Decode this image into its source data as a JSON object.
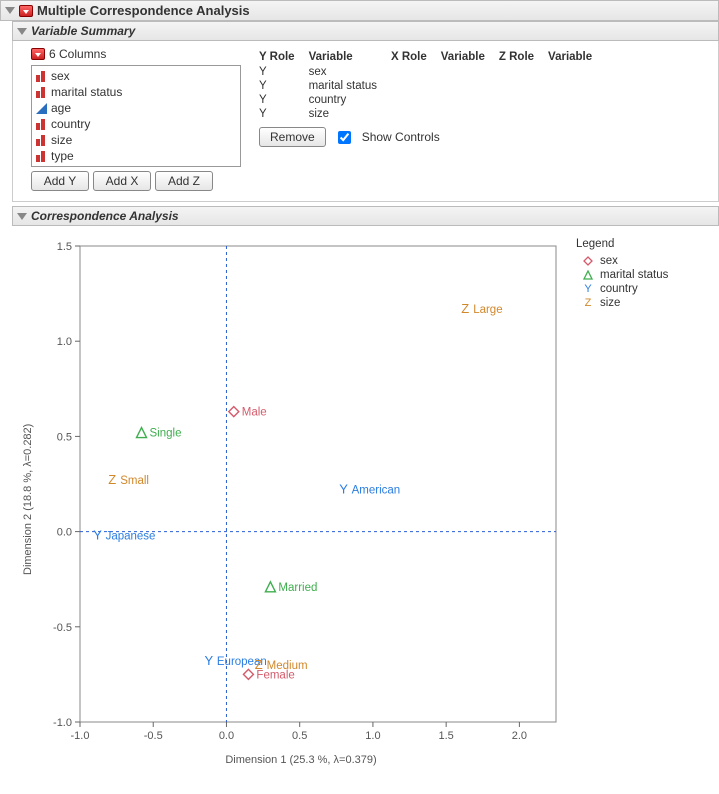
{
  "main_title": "Multiple Correspondence Analysis",
  "variable_summary": {
    "title": "Variable Summary",
    "columns_count_label": "6 Columns",
    "columns": [
      {
        "name": "sex",
        "type": "nominal"
      },
      {
        "name": "marital status",
        "type": "nominal"
      },
      {
        "name": "age",
        "type": "continuous"
      },
      {
        "name": "country",
        "type": "nominal"
      },
      {
        "name": "size",
        "type": "nominal"
      },
      {
        "name": "type",
        "type": "nominal"
      }
    ],
    "buttons": {
      "add_y": "Add Y",
      "add_x": "Add X",
      "add_z": "Add Z"
    },
    "role_headers": {
      "y_role": "Y Role",
      "variable1": "Variable",
      "x_role": "X Role",
      "variable2": "Variable",
      "z_role": "Z Role",
      "variable3": "Variable"
    },
    "role_rows": [
      {
        "role": "Y",
        "variable": "sex"
      },
      {
        "role": "Y",
        "variable": "marital status"
      },
      {
        "role": "Y",
        "variable": "country"
      },
      {
        "role": "Y",
        "variable": "size"
      }
    ],
    "remove_label": "Remove",
    "show_controls_label": "Show Controls"
  },
  "correspondence_analysis": {
    "title": "Correspondence Analysis",
    "legend_title": "Legend",
    "legend": [
      {
        "label": "sex",
        "symbol": "diamond",
        "color": "#d35b6b"
      },
      {
        "label": "marital status",
        "symbol": "triangle",
        "color": "#3eae4e"
      },
      {
        "label": "country",
        "symbol": "Y",
        "color": "#2a7de1"
      },
      {
        "label": "size",
        "symbol": "Z",
        "color": "#d1882b"
      }
    ]
  },
  "chart_data": {
    "type": "scatter",
    "xlabel": "Dimension 1  (25.3 %, λ=0.379)",
    "ylabel": "Dimension 2  (18.8 %, λ=0.282)",
    "xlim": [
      -1.0,
      2.25
    ],
    "ylim": [
      -1.0,
      1.5
    ],
    "xticks": [
      -1.0,
      -0.5,
      0.0,
      0.5,
      1.0,
      1.5,
      2.0
    ],
    "yticks": [
      -1.0,
      -0.5,
      0.0,
      0.5,
      1.0,
      1.5
    ],
    "reference_lines": {
      "x": 0.0,
      "y": 0.0
    },
    "series": [
      {
        "name": "sex",
        "symbol": "diamond",
        "color": "#d35b6b",
        "points": [
          {
            "label": "Male",
            "x": 0.05,
            "y": 0.63
          },
          {
            "label": "Female",
            "x": 0.15,
            "y": -0.75
          }
        ]
      },
      {
        "name": "marital status",
        "symbol": "triangle",
        "color": "#3eae4e",
        "points": [
          {
            "label": "Single",
            "x": -0.58,
            "y": 0.52
          },
          {
            "label": "Married",
            "x": 0.3,
            "y": -0.29
          }
        ]
      },
      {
        "name": "country",
        "symbol": "Y",
        "color": "#2a7de1",
        "points": [
          {
            "label": "Japanese",
            "x": -0.88,
            "y": -0.02
          },
          {
            "label": "American",
            "x": 0.8,
            "y": 0.22
          },
          {
            "label": "European",
            "x": -0.12,
            "y": -0.68
          }
        ]
      },
      {
        "name": "size",
        "symbol": "Z",
        "color": "#d1882b",
        "points": [
          {
            "label": "Large",
            "x": 1.63,
            "y": 1.17
          },
          {
            "label": "Small",
            "x": -0.78,
            "y": 0.27
          },
          {
            "label": "Medium",
            "x": 0.22,
            "y": -0.7
          }
        ]
      }
    ]
  }
}
